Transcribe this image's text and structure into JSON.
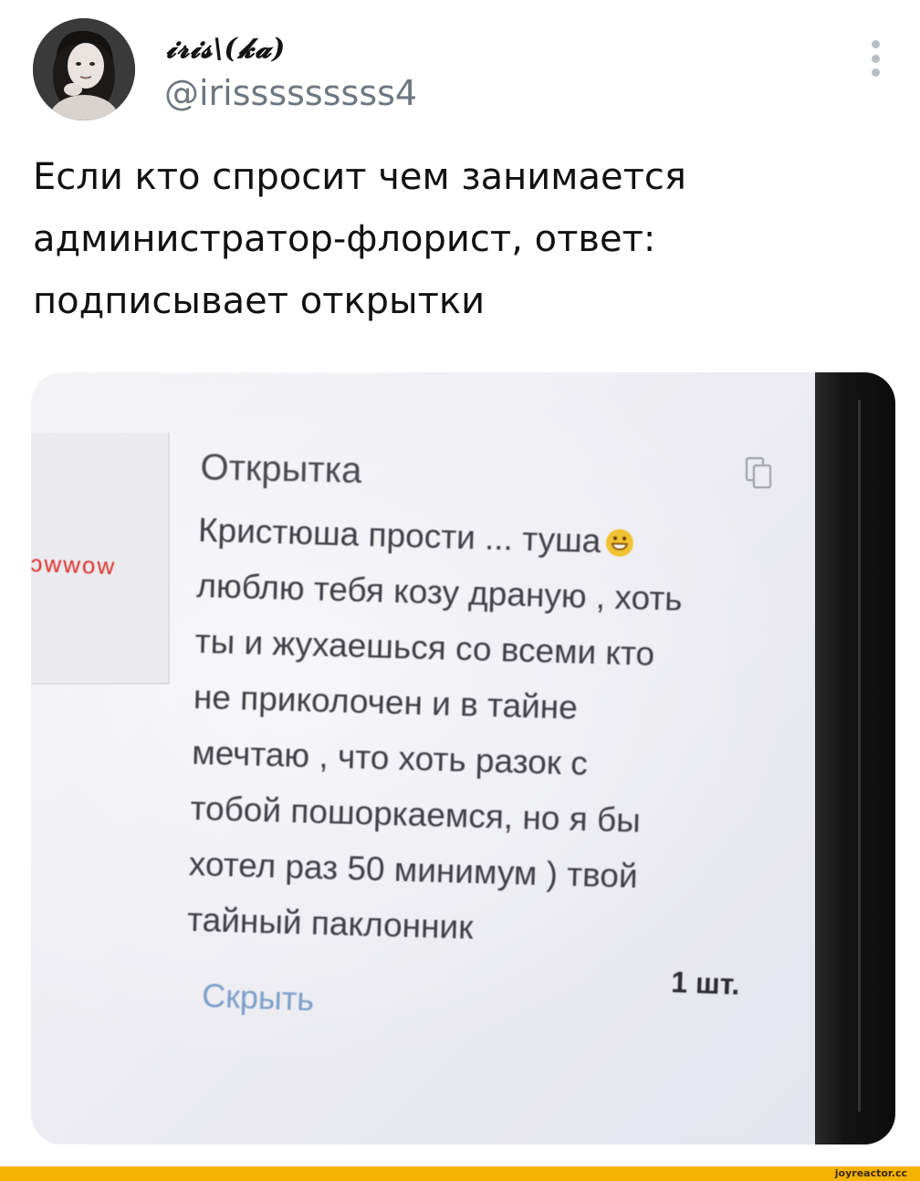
{
  "tweet": {
    "author": {
      "display_name": "𝓲𝓻𝓲𝓼\\(𝓴𝓪)",
      "handle": "@irisssssssss4"
    },
    "text_lines": [
      "Если кто спросит чем занимается",
      "администратор-флорист, ответ:",
      "подписывает открытки"
    ],
    "more_icon": "vertical-ellipsis-icon"
  },
  "photo": {
    "thumbnail_label": "ɔwwow",
    "card": {
      "title": "Открытка",
      "body_lines": [
        "Кристюша прости ... туша",
        "люблю тебя козу драную , хоть",
        "ты и жухаешься со всеми кто",
        "не приколочен и в тайне",
        "мечтаю , что хоть разок с",
        "тобой пошоркаемся, но я бы",
        "хотел раз 50 минимум ) твой",
        "тайный паклонник"
      ],
      "emoji": "grinning-face-icon",
      "hide_label": "Скрыть",
      "quantity": "1 шт.",
      "copy_icon": "copy-icon"
    }
  },
  "footer": {
    "watermark": "joyreactor.cc",
    "bar_color": "#f5b301"
  }
}
